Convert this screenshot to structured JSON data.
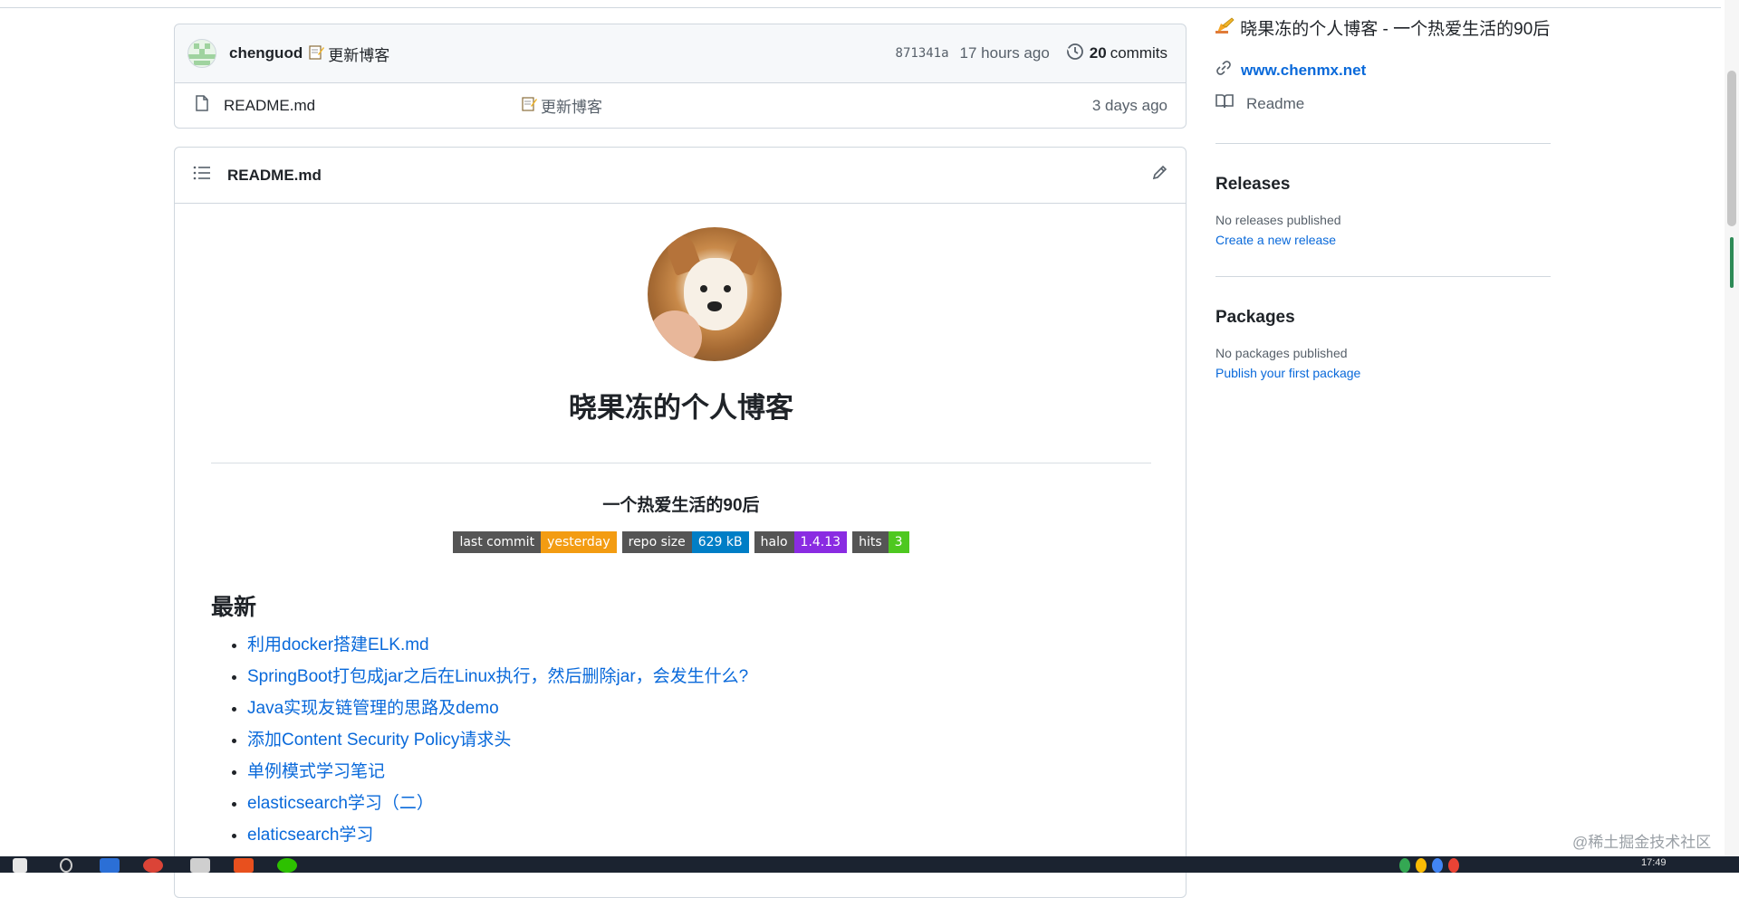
{
  "commit_bar": {
    "author": "chenguod",
    "message": "更新博客",
    "sha": "871341a",
    "time": "17 hours ago",
    "commit_count": "20",
    "commit_label": "commits"
  },
  "file_row": {
    "name": "README.md",
    "message": "更新博客",
    "time": "3 days ago"
  },
  "readme": {
    "header_title": "README.md",
    "title": "晓果冻的个人博客",
    "subtitle": "一个热爱生活的90后",
    "badges": [
      {
        "key": "last commit",
        "value": "yesterday",
        "color": "#f39c12"
      },
      {
        "key": "repo size",
        "value": "629 kB",
        "color": "#007ec6"
      },
      {
        "key": "halo",
        "value": "1.4.13",
        "color": "#8a2be2"
      },
      {
        "key": "hits",
        "value": "3",
        "color": "#4ec820"
      }
    ],
    "section_title": "最新",
    "posts": [
      "利用docker搭建ELK.md",
      "SpringBoot打包成jar之后在Linux执行，然后删除jar，会发生什么?",
      "Java实现友链管理的思路及demo",
      "添加Content Security Policy请求头",
      "单例模式学习笔记",
      "elasticsearch学习（二）",
      "elaticsearch学习"
    ]
  },
  "sidebar": {
    "about": "晓果冻的个人博客 - 一个热爱生活的90后",
    "website": "www.chenmx.net",
    "readme_label": "Readme",
    "releases_title": "Releases",
    "releases_empty": "No releases published",
    "releases_link": "Create a new release",
    "packages_title": "Packages",
    "packages_empty": "No packages published",
    "packages_link": "Publish your first package"
  },
  "watermark": "@稀土掘金技术社区",
  "taskbar": {
    "time": "17:49"
  },
  "icons": {
    "file": "file-icon",
    "history": "history-icon",
    "list": "list-icon",
    "pencil": "pencil-icon",
    "link": "link-icon",
    "book": "book-icon",
    "memo": "memo-emoji"
  }
}
